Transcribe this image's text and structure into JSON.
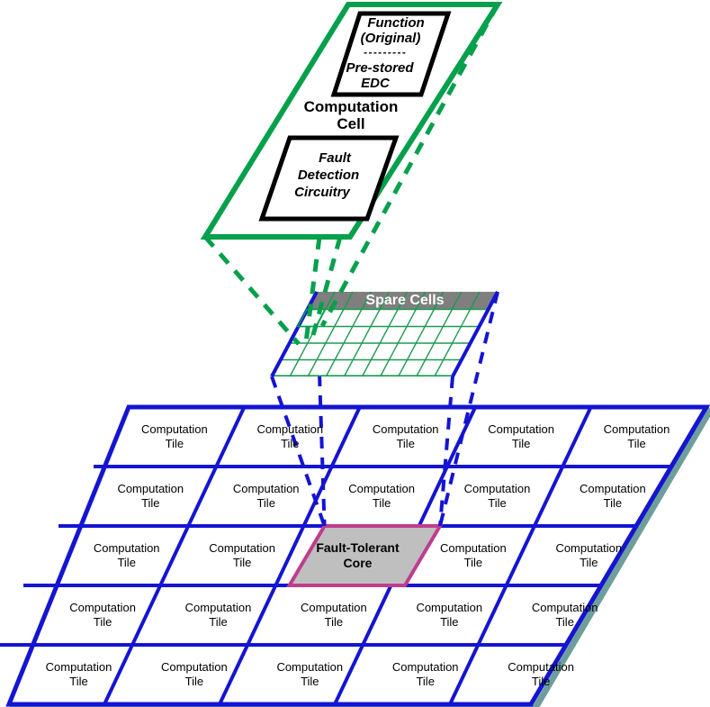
{
  "diagram": {
    "title": "Fault-Tolerant Core Architecture",
    "colors": {
      "green": "#05A04C",
      "blue": "#1414D2",
      "magenta": "#BE3D8C",
      "core_fill": "#BFBFBF",
      "spare_band_fill": "#7F7F7F",
      "grid_green": "#1C9B52",
      "shadow_teal": "#6E9E9B",
      "black": "#000000",
      "white": "#FFFFFF"
    }
  },
  "computation_cell": {
    "title": "Computation\nCell",
    "title_line1": "Computation",
    "title_line2": "Cell",
    "function_box": {
      "name": "function-original-box",
      "line1": "Function",
      "line2": "(Original)",
      "separator": "- - - - - - - - -",
      "line3": "Pre-stored",
      "line4": "EDC"
    },
    "fault_box": {
      "name": "fault-detection-circuitry-box",
      "line1": "Fault",
      "line2": "Detection",
      "line3": "Circuitry"
    }
  },
  "spare_cells": {
    "label": "Spare Cells",
    "columns": 10,
    "rows": 5
  },
  "tile_array": {
    "rows": 5,
    "cols": 5,
    "tile_label_line1": "Computation",
    "tile_label_line2": "Tile",
    "core": {
      "row": 2,
      "col": 2,
      "label_line1": "Fault-Tolerant",
      "label_line2": "Core"
    },
    "tiles": [
      [
        {
          "l1": "Computation",
          "l2": "Tile"
        },
        {
          "l1": "Computation",
          "l2": "Tile"
        },
        {
          "l1": "Computation",
          "l2": "Tile"
        },
        {
          "l1": "Computation",
          "l2": "Tile"
        },
        {
          "l1": "Computation",
          "l2": "Tile"
        }
      ],
      [
        {
          "l1": "Computation",
          "l2": "Tile"
        },
        {
          "l1": "Computation",
          "l2": "Tile"
        },
        {
          "l1": "Computation",
          "l2": "Tile"
        },
        {
          "l1": "Computation",
          "l2": "Tile"
        },
        {
          "l1": "Computation",
          "l2": "Tile"
        }
      ],
      [
        {
          "l1": "Computation",
          "l2": "Tile"
        },
        {
          "l1": "Computation",
          "l2": "Tile"
        },
        {
          "l1": "Fault-Tolerant",
          "l2": "Core",
          "core": true
        },
        {
          "l1": "Computation",
          "l2": "Tile"
        },
        {
          "l1": "Computation",
          "l2": "Tile"
        }
      ],
      [
        {
          "l1": "Computation",
          "l2": "Tile"
        },
        {
          "l1": "Computation",
          "l2": "Tile"
        },
        {
          "l1": "Computation",
          "l2": "Tile"
        },
        {
          "l1": "Computation",
          "l2": "Tile"
        },
        {
          "l1": "Computation",
          "l2": "Tile"
        }
      ],
      [
        {
          "l1": "Computation",
          "l2": "Tile"
        },
        {
          "l1": "Computation",
          "l2": "Tile"
        },
        {
          "l1": "Computation",
          "l2": "Tile"
        },
        {
          "l1": "Computation",
          "l2": "Tile"
        },
        {
          "l1": "Computation",
          "l2": "Tile"
        }
      ]
    ]
  }
}
